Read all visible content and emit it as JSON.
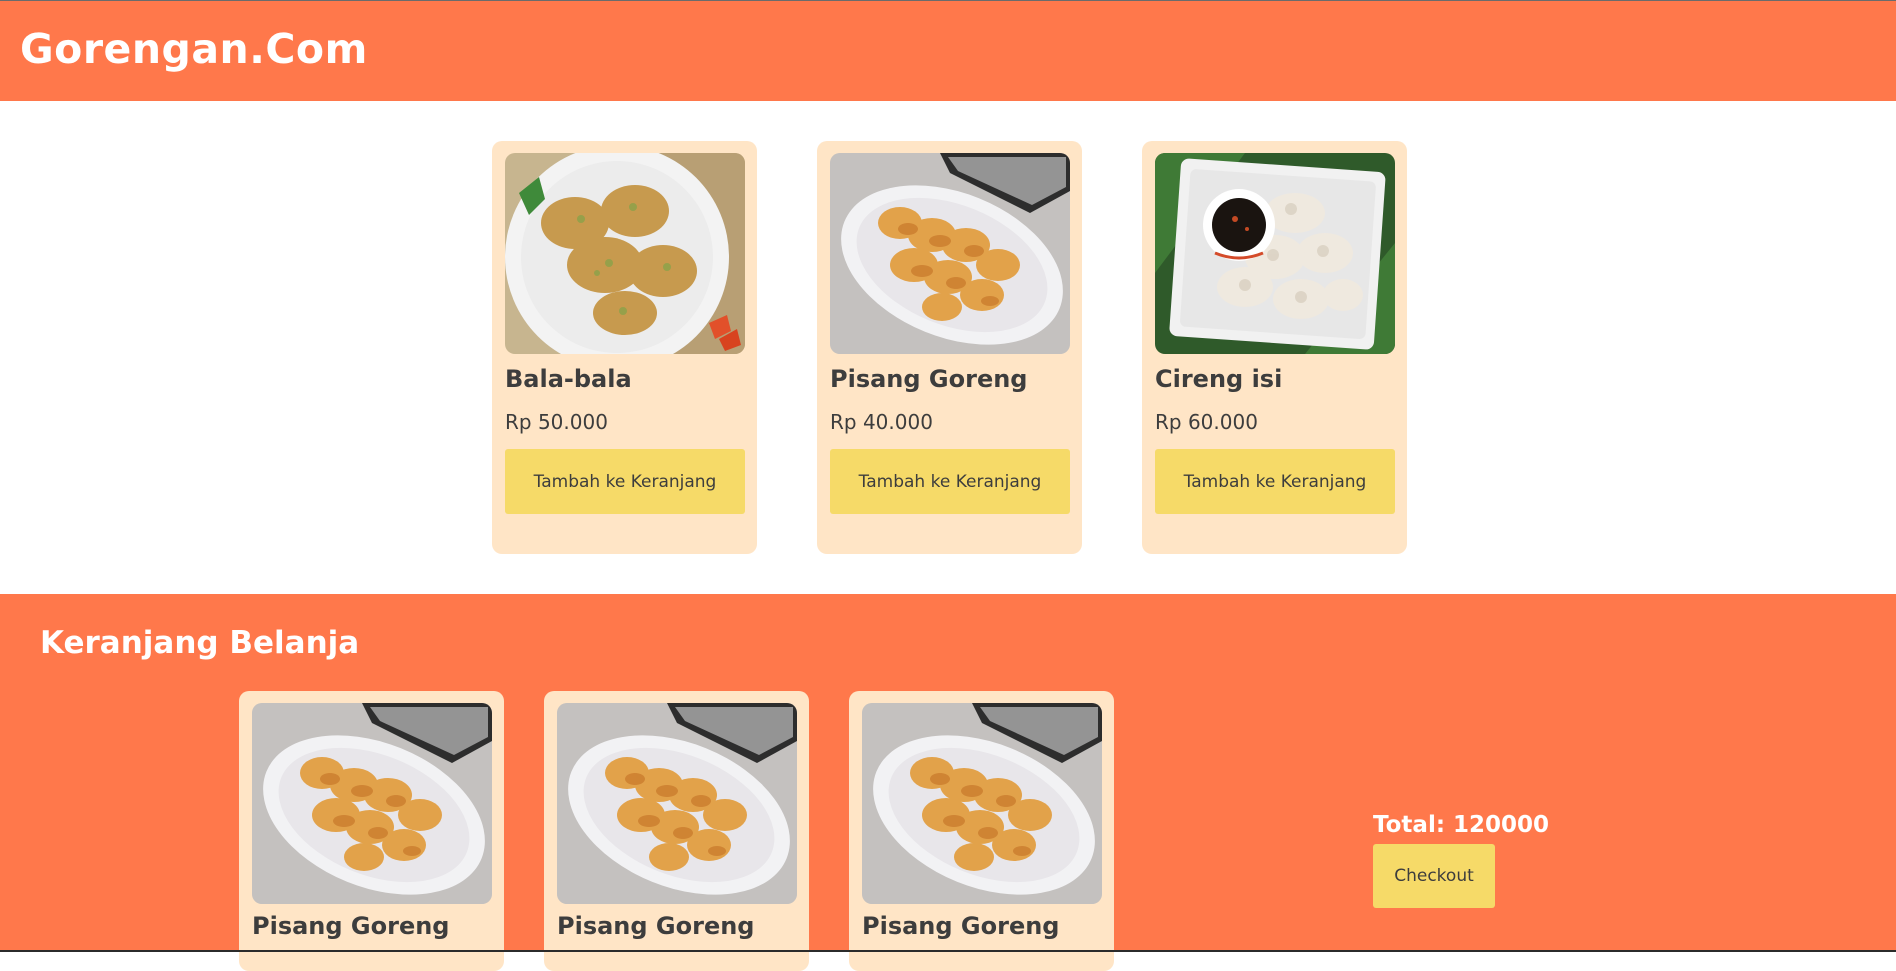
{
  "header": {
    "brand": "Gorengan.Com"
  },
  "products": [
    {
      "name": "Bala-bala",
      "price": "Rp 50.000",
      "button_label": "Tambah ke Keranjang",
      "image_icon": "bala-bala-food-image"
    },
    {
      "name": "Pisang Goreng",
      "price": "Rp 40.000",
      "button_label": "Tambah ke Keranjang",
      "image_icon": "pisang-goreng-food-image"
    },
    {
      "name": "Cireng isi",
      "price": "Rp 60.000",
      "button_label": "Tambah ke Keranjang",
      "image_icon": "cireng-isi-food-image"
    }
  ],
  "cart": {
    "title": "Keranjang Belanja",
    "items": [
      {
        "name": "Pisang Goreng"
      },
      {
        "name": "Pisang Goreng"
      },
      {
        "name": "Pisang Goreng"
      }
    ],
    "total_label": "Total: 120000",
    "checkout_label": "Checkout"
  },
  "colors": {
    "accent": "#ff784b",
    "card_bg": "#ffe5c6",
    "button_bg": "#f6da68",
    "text": "#3d3d3d"
  }
}
